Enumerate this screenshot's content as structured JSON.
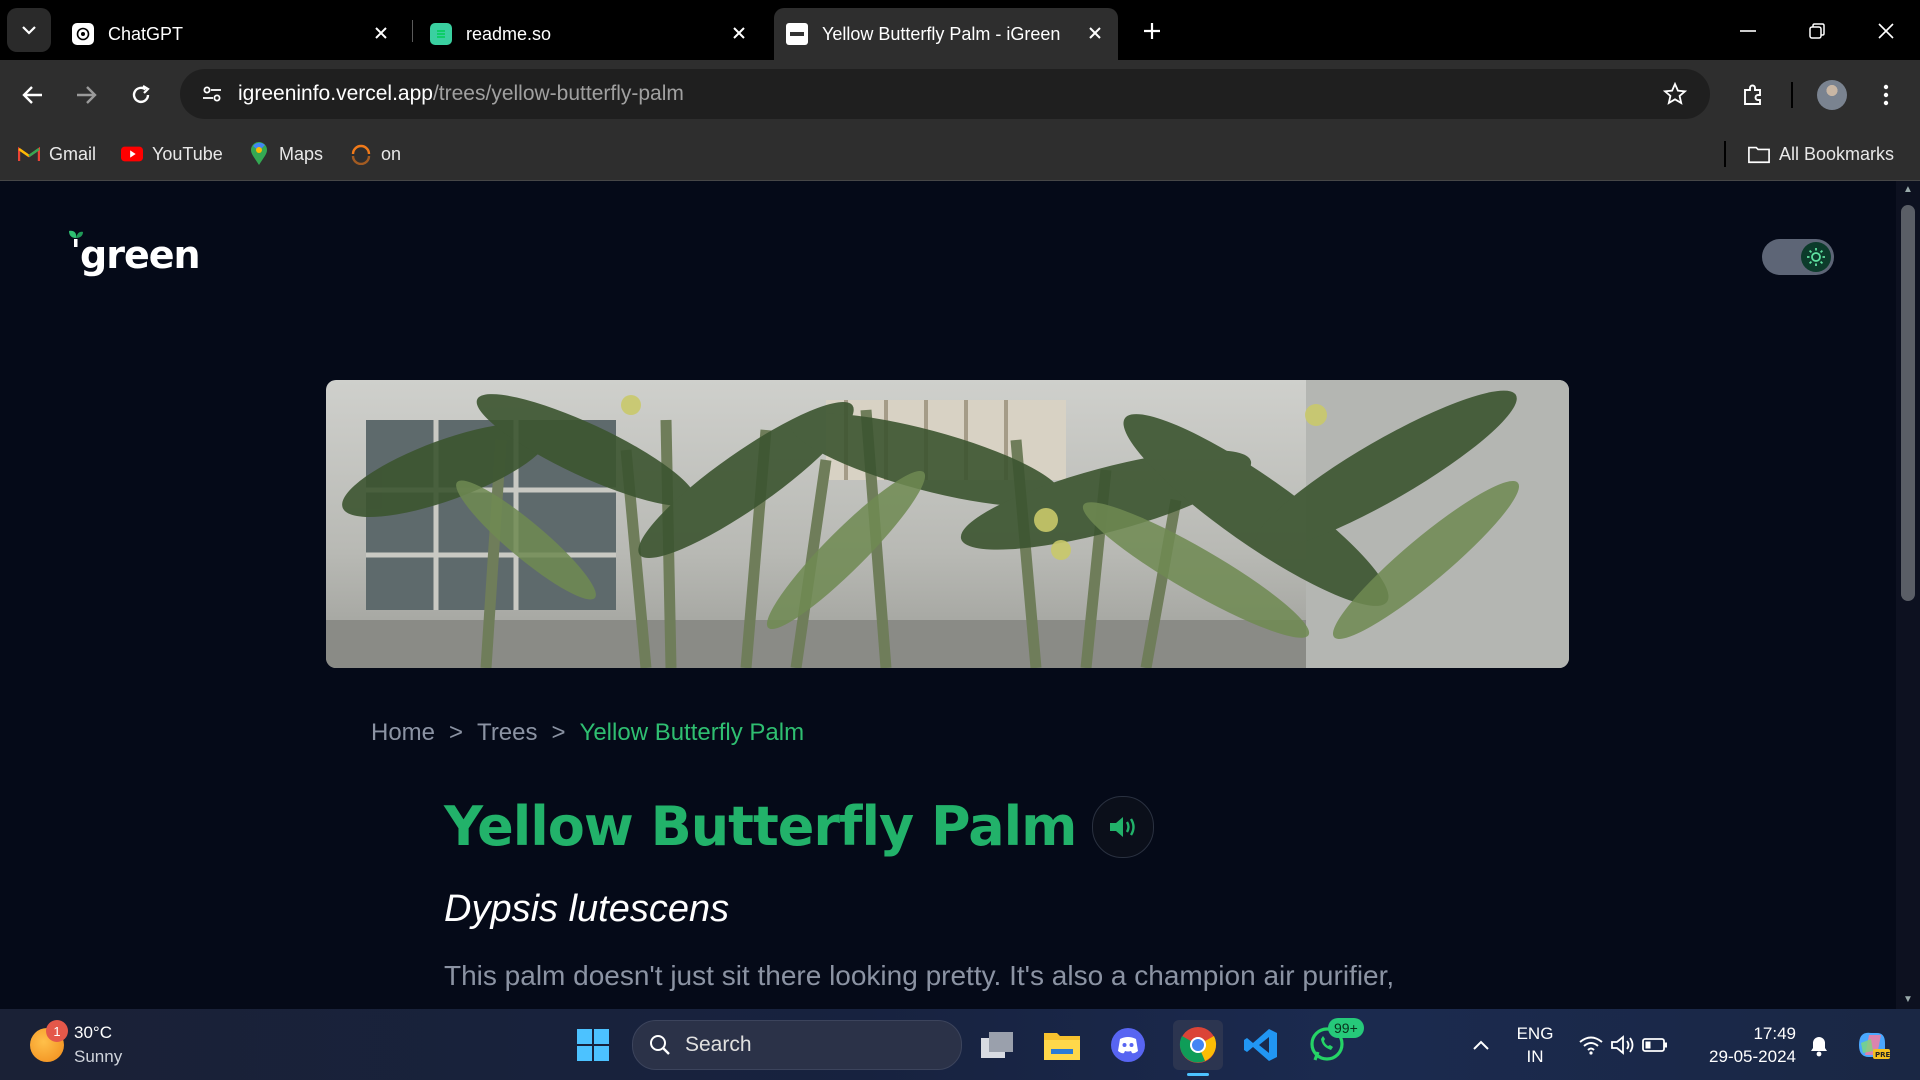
{
  "browser": {
    "tabs": [
      {
        "label": "ChatGPT",
        "active": false
      },
      {
        "label": "readme.so",
        "active": false
      },
      {
        "label": "Yellow Butterfly Palm - iGreen",
        "active": true
      }
    ],
    "url_host": "igreeninfo.vercel.app",
    "url_path": "/trees/yellow-butterfly-palm",
    "bookmarks": [
      {
        "label": "Gmail",
        "icon": "gmail-icon"
      },
      {
        "label": "YouTube",
        "icon": "youtube-icon"
      },
      {
        "label": "Maps",
        "icon": "maps-icon"
      },
      {
        "label": "on",
        "icon": "loading-icon"
      }
    ],
    "all_bookmarks": "All Bookmarks"
  },
  "page": {
    "logo": "green",
    "breadcrumb": {
      "home": "Home",
      "trees": "Trees",
      "current": "Yellow Butterfly Palm",
      "separator": ">"
    },
    "title": "Yellow Butterfly Palm",
    "scientific_name": "Dypsis lutescens",
    "description": "This palm doesn't just sit there looking pretty. It's also a champion air purifier,"
  },
  "colors": {
    "page_bg": "#050a18",
    "accent": "#22b26a",
    "muted_text": "#8b93a3"
  },
  "taskbar": {
    "weather": {
      "temp": "30°C",
      "condition": "Sunny",
      "badge": "1"
    },
    "search_label": "Search",
    "whatsapp_badge": "99+",
    "language": {
      "line1": "ENG",
      "line2": "IN"
    },
    "clock": {
      "time": "17:49",
      "date": "29-05-2024"
    }
  }
}
